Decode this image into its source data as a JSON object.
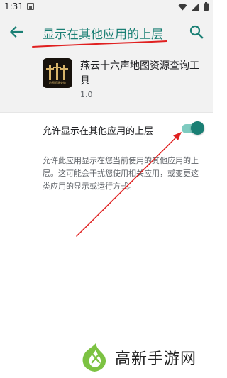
{
  "status_bar": {
    "time": "1:31"
  },
  "header": {
    "title": "显示在其他应用的上层"
  },
  "app_info": {
    "name": "燕云十六声地图资源查询工具",
    "version": "1.0",
    "icon_caption": "地图资源查询"
  },
  "setting": {
    "label": "允许显示在其他应用的上层",
    "enabled": true,
    "description": "允许此应用显示在您当前使用的其他应用的上层。这可能会干扰您使用相关应用，或变更这类应用的显示或运行方式。"
  },
  "watermark": {
    "text": "高新手游网"
  },
  "colors": {
    "accent": "#1a7f74",
    "toggle_track": "#7ecbc0",
    "annotation": "#e02020",
    "watermark_green": "#7cc242"
  }
}
